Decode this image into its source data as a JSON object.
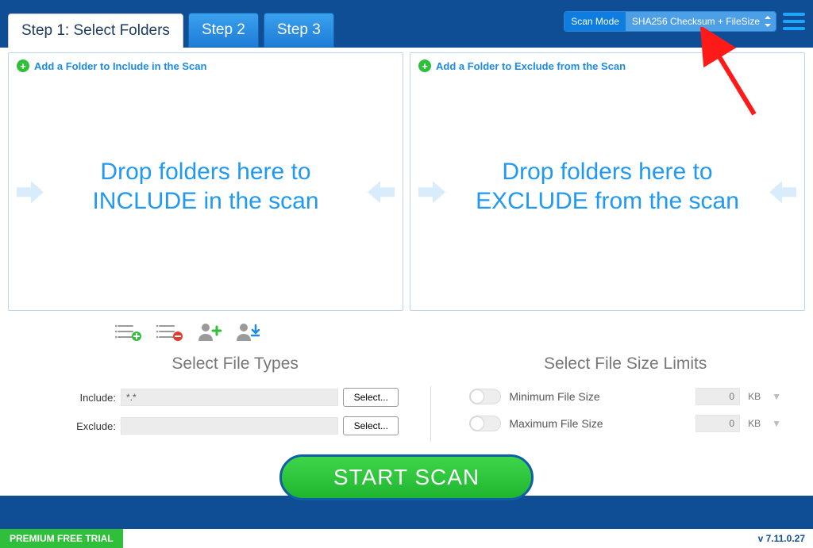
{
  "tabs": {
    "step1": "Step 1: Select Folders",
    "step2": "Step 2",
    "step3": "Step 3"
  },
  "scanmode": {
    "label": "Scan Mode",
    "value": "SHA256 Checksum + FileSize"
  },
  "panels": {
    "include": {
      "add": "Add a Folder to Include in the Scan",
      "center": "Drop folders here to INCLUDE in the scan"
    },
    "exclude": {
      "add": "Add a Folder to Exclude from the Scan",
      "center": "Drop folders here to EXCLUDE from the scan"
    }
  },
  "filetypes": {
    "title": "Select File Types",
    "include_label": "Include:",
    "include_value": "*.*",
    "exclude_label": "Exclude:",
    "exclude_value": "",
    "select_btn": "Select..."
  },
  "filesize": {
    "title": "Select File Size Limits",
    "min_label": "Minimum File Size",
    "max_label": "Maximum File Size",
    "min_value": "0",
    "max_value": "0",
    "unit": "KB"
  },
  "start": "START SCAN",
  "status": {
    "trial": "PREMIUM FREE TRIAL",
    "version": "v 7.11.0.27"
  }
}
